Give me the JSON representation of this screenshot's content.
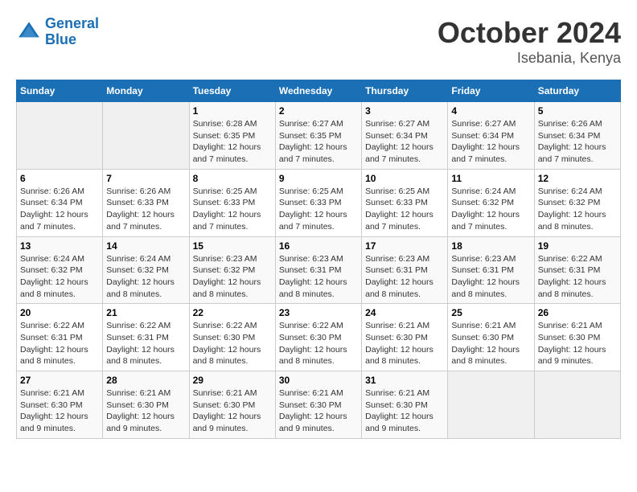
{
  "header": {
    "logo_line1": "General",
    "logo_line2": "Blue",
    "month": "October 2024",
    "location": "Isebania, Kenya"
  },
  "days_of_week": [
    "Sunday",
    "Monday",
    "Tuesday",
    "Wednesday",
    "Thursday",
    "Friday",
    "Saturday"
  ],
  "weeks": [
    [
      {
        "day": "",
        "info": ""
      },
      {
        "day": "",
        "info": ""
      },
      {
        "day": "1",
        "info": "Sunrise: 6:28 AM\nSunset: 6:35 PM\nDaylight: 12 hours\nand 7 minutes."
      },
      {
        "day": "2",
        "info": "Sunrise: 6:27 AM\nSunset: 6:35 PM\nDaylight: 12 hours\nand 7 minutes."
      },
      {
        "day": "3",
        "info": "Sunrise: 6:27 AM\nSunset: 6:34 PM\nDaylight: 12 hours\nand 7 minutes."
      },
      {
        "day": "4",
        "info": "Sunrise: 6:27 AM\nSunset: 6:34 PM\nDaylight: 12 hours\nand 7 minutes."
      },
      {
        "day": "5",
        "info": "Sunrise: 6:26 AM\nSunset: 6:34 PM\nDaylight: 12 hours\nand 7 minutes."
      }
    ],
    [
      {
        "day": "6",
        "info": "Sunrise: 6:26 AM\nSunset: 6:34 PM\nDaylight: 12 hours\nand 7 minutes."
      },
      {
        "day": "7",
        "info": "Sunrise: 6:26 AM\nSunset: 6:33 PM\nDaylight: 12 hours\nand 7 minutes."
      },
      {
        "day": "8",
        "info": "Sunrise: 6:25 AM\nSunset: 6:33 PM\nDaylight: 12 hours\nand 7 minutes."
      },
      {
        "day": "9",
        "info": "Sunrise: 6:25 AM\nSunset: 6:33 PM\nDaylight: 12 hours\nand 7 minutes."
      },
      {
        "day": "10",
        "info": "Sunrise: 6:25 AM\nSunset: 6:33 PM\nDaylight: 12 hours\nand 7 minutes."
      },
      {
        "day": "11",
        "info": "Sunrise: 6:24 AM\nSunset: 6:32 PM\nDaylight: 12 hours\nand 7 minutes."
      },
      {
        "day": "12",
        "info": "Sunrise: 6:24 AM\nSunset: 6:32 PM\nDaylight: 12 hours\nand 8 minutes."
      }
    ],
    [
      {
        "day": "13",
        "info": "Sunrise: 6:24 AM\nSunset: 6:32 PM\nDaylight: 12 hours\nand 8 minutes."
      },
      {
        "day": "14",
        "info": "Sunrise: 6:24 AM\nSunset: 6:32 PM\nDaylight: 12 hours\nand 8 minutes."
      },
      {
        "day": "15",
        "info": "Sunrise: 6:23 AM\nSunset: 6:32 PM\nDaylight: 12 hours\nand 8 minutes."
      },
      {
        "day": "16",
        "info": "Sunrise: 6:23 AM\nSunset: 6:31 PM\nDaylight: 12 hours\nand 8 minutes."
      },
      {
        "day": "17",
        "info": "Sunrise: 6:23 AM\nSunset: 6:31 PM\nDaylight: 12 hours\nand 8 minutes."
      },
      {
        "day": "18",
        "info": "Sunrise: 6:23 AM\nSunset: 6:31 PM\nDaylight: 12 hours\nand 8 minutes."
      },
      {
        "day": "19",
        "info": "Sunrise: 6:22 AM\nSunset: 6:31 PM\nDaylight: 12 hours\nand 8 minutes."
      }
    ],
    [
      {
        "day": "20",
        "info": "Sunrise: 6:22 AM\nSunset: 6:31 PM\nDaylight: 12 hours\nand 8 minutes."
      },
      {
        "day": "21",
        "info": "Sunrise: 6:22 AM\nSunset: 6:31 PM\nDaylight: 12 hours\nand 8 minutes."
      },
      {
        "day": "22",
        "info": "Sunrise: 6:22 AM\nSunset: 6:30 PM\nDaylight: 12 hours\nand 8 minutes."
      },
      {
        "day": "23",
        "info": "Sunrise: 6:22 AM\nSunset: 6:30 PM\nDaylight: 12 hours\nand 8 minutes."
      },
      {
        "day": "24",
        "info": "Sunrise: 6:21 AM\nSunset: 6:30 PM\nDaylight: 12 hours\nand 8 minutes."
      },
      {
        "day": "25",
        "info": "Sunrise: 6:21 AM\nSunset: 6:30 PM\nDaylight: 12 hours\nand 8 minutes."
      },
      {
        "day": "26",
        "info": "Sunrise: 6:21 AM\nSunset: 6:30 PM\nDaylight: 12 hours\nand 9 minutes."
      }
    ],
    [
      {
        "day": "27",
        "info": "Sunrise: 6:21 AM\nSunset: 6:30 PM\nDaylight: 12 hours\nand 9 minutes."
      },
      {
        "day": "28",
        "info": "Sunrise: 6:21 AM\nSunset: 6:30 PM\nDaylight: 12 hours\nand 9 minutes."
      },
      {
        "day": "29",
        "info": "Sunrise: 6:21 AM\nSunset: 6:30 PM\nDaylight: 12 hours\nand 9 minutes."
      },
      {
        "day": "30",
        "info": "Sunrise: 6:21 AM\nSunset: 6:30 PM\nDaylight: 12 hours\nand 9 minutes."
      },
      {
        "day": "31",
        "info": "Sunrise: 6:21 AM\nSunset: 6:30 PM\nDaylight: 12 hours\nand 9 minutes."
      },
      {
        "day": "",
        "info": ""
      },
      {
        "day": "",
        "info": ""
      }
    ]
  ]
}
